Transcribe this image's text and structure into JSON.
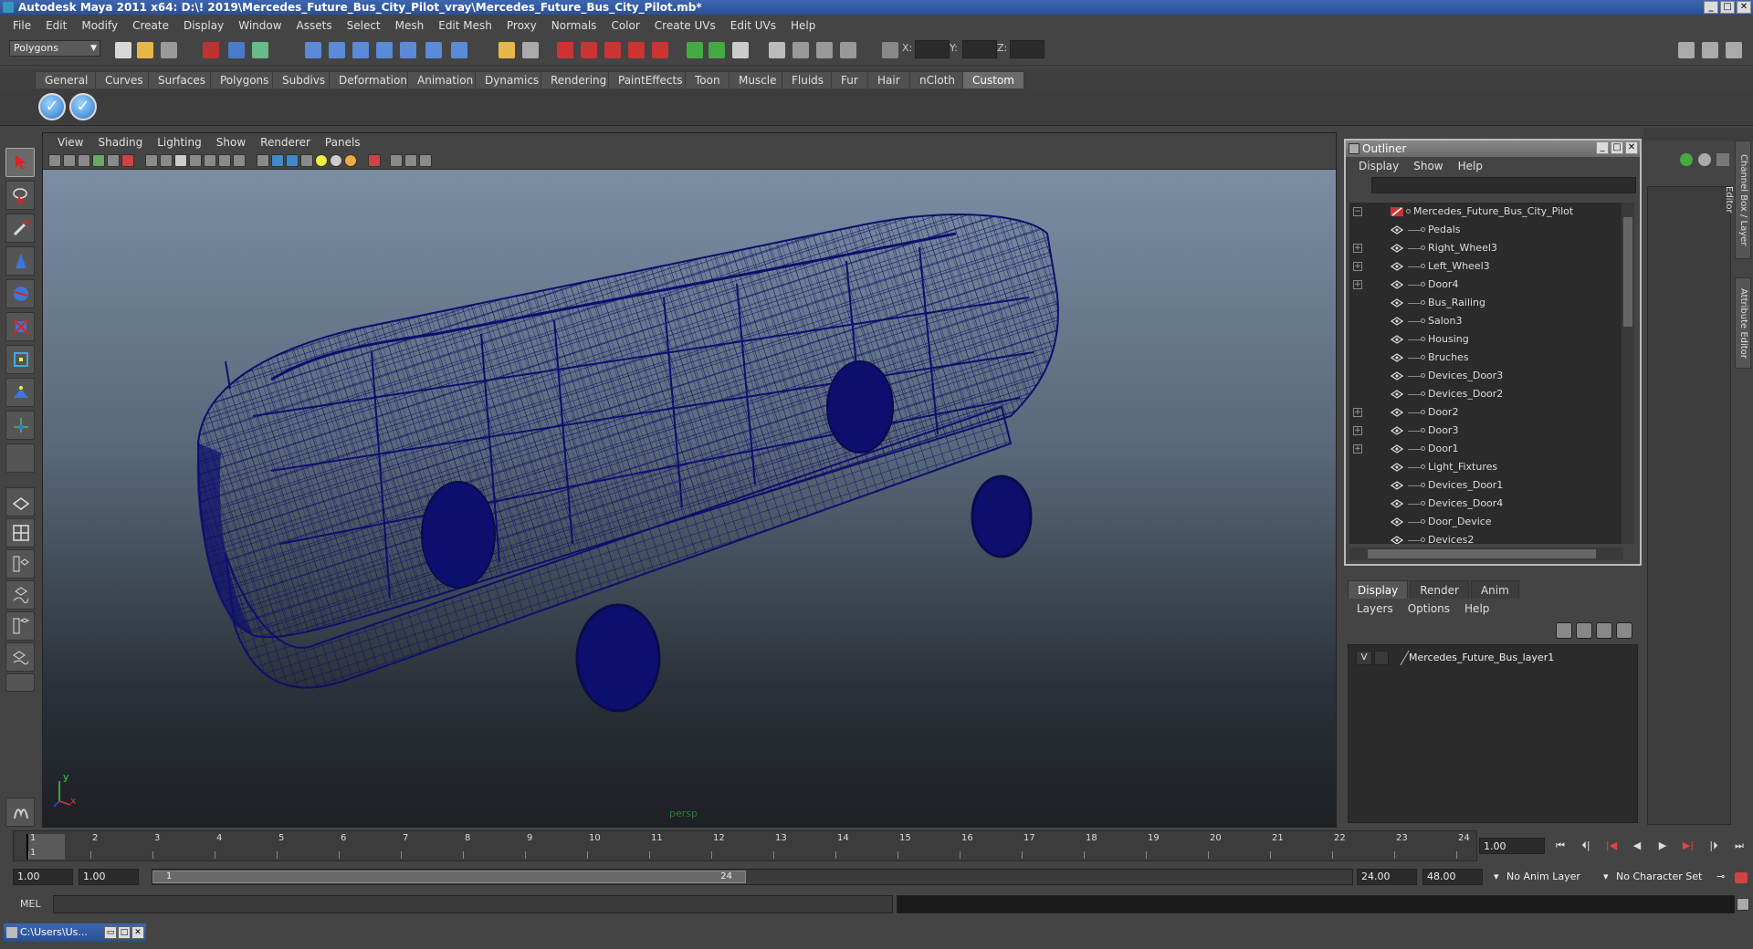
{
  "window": {
    "title": "Autodesk Maya 2011 x64: D:\\! 2019\\Mercedes_Future_Bus_City_Pilot_vray\\Mercedes_Future_Bus_City_Pilot.mb*",
    "min": "_",
    "max": "□",
    "close": "✕"
  },
  "menubar": [
    "File",
    "Edit",
    "Modify",
    "Create",
    "Display",
    "Window",
    "Assets",
    "Select",
    "Mesh",
    "Edit Mesh",
    "Proxy",
    "Normals",
    "Color",
    "Create UVs",
    "Edit UVs",
    "Help"
  ],
  "toolbar": {
    "mode": "Polygons",
    "x_label": "X:",
    "y_label": "Y:",
    "z_label": "Z:"
  },
  "shelf": {
    "tabs": [
      "General",
      "Curves",
      "Surfaces",
      "Polygons",
      "Subdivs",
      "Deformation",
      "Animation",
      "Dynamics",
      "Rendering",
      "PaintEffects",
      "Toon",
      "Muscle",
      "Fluids",
      "Fur",
      "Hair",
      "nCloth",
      "Custom"
    ],
    "active_tab": "Custom",
    "buttons": [
      "check-icon",
      "check-icon"
    ]
  },
  "viewport": {
    "menu": [
      "View",
      "Shading",
      "Lighting",
      "Show",
      "Renderer",
      "Panels"
    ],
    "camera_label": "persp",
    "axis_y": "y",
    "axis_x": "x",
    "wire_color": "#0d0f6e"
  },
  "outliner": {
    "title": "Outliner",
    "menu": [
      "Display",
      "Show",
      "Help"
    ],
    "root": "Mercedes_Future_Bus_City_Pilot",
    "items": [
      {
        "label": "Pedals",
        "expandable": false
      },
      {
        "label": "Right_Wheel3",
        "expandable": true
      },
      {
        "label": "Left_Wheel3",
        "expandable": true
      },
      {
        "label": "Door4",
        "expandable": true
      },
      {
        "label": "Bus_Railing",
        "expandable": false
      },
      {
        "label": "Salon3",
        "expandable": false
      },
      {
        "label": "Housing",
        "expandable": false
      },
      {
        "label": "Bruches",
        "expandable": false
      },
      {
        "label": "Devices_Door3",
        "expandable": false
      },
      {
        "label": "Devices_Door2",
        "expandable": false
      },
      {
        "label": "Door2",
        "expandable": true
      },
      {
        "label": "Door3",
        "expandable": true
      },
      {
        "label": "Door1",
        "expandable": true
      },
      {
        "label": "Light_Fixtures",
        "expandable": false
      },
      {
        "label": "Devices_Door1",
        "expandable": false
      },
      {
        "label": "Devices_Door4",
        "expandable": false
      },
      {
        "label": "Door_Device",
        "expandable": false
      },
      {
        "label": "Devices2",
        "expandable": false
      }
    ]
  },
  "layers": {
    "tabs": [
      "Display",
      "Render",
      "Anim"
    ],
    "active_tab": "Display",
    "menu": [
      "Layers",
      "Options",
      "Help"
    ],
    "rows": [
      {
        "visible": "V",
        "name": "Mercedes_Future_Bus_layer1"
      }
    ]
  },
  "right_tabs": [
    "Channel Box / Layer Editor",
    "Attribute Editor"
  ],
  "timeline": {
    "ticks": [
      "1",
      "2",
      "3",
      "4",
      "5",
      "6",
      "7",
      "8",
      "9",
      "10",
      "11",
      "12",
      "13",
      "14",
      "15",
      "16",
      "17",
      "18",
      "19",
      "20",
      "21",
      "22",
      "23",
      "24"
    ],
    "current_marker": "1",
    "current_frame": "1.00"
  },
  "range": {
    "start": "1.00",
    "playback_start": "1.00",
    "slider_start": "1",
    "slider_end": "24",
    "playback_end": "24.00",
    "end": "48.00",
    "anim_layer": "No Anim Layer",
    "character_set": "No Character Set"
  },
  "cmdline": {
    "label": "MEL"
  },
  "taskbar": {
    "item": "C:\\Users\\Us..."
  }
}
